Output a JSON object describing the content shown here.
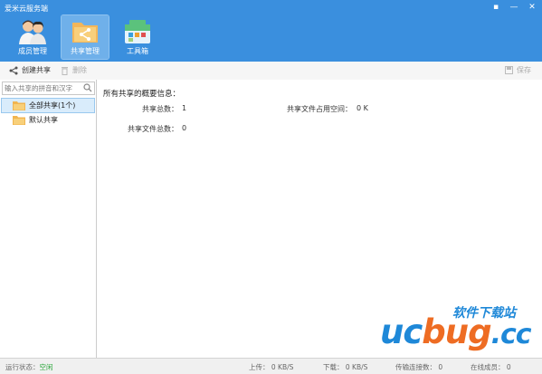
{
  "window": {
    "title": "爱米云服务端",
    "controls": [
      "▪",
      "—",
      "✕"
    ]
  },
  "nav": [
    {
      "label": "成员管理",
      "icon": "members-icon"
    },
    {
      "label": "共享管理",
      "icon": "share-icon",
      "active": true
    },
    {
      "label": "工具箱",
      "icon": "toolbox-icon"
    }
  ],
  "toolbar": {
    "create_label": "创建共享",
    "delete_label": "删除",
    "save_label": "保存"
  },
  "sidebar": {
    "search_placeholder": "输入共享的拼音和汉字",
    "items": [
      {
        "label": "全部共享(1个)",
        "selected": true
      },
      {
        "label": "默认共享",
        "selected": false
      }
    ]
  },
  "main": {
    "title": "所有共享的概要信息：",
    "share_count_label": "共享总数：",
    "share_count_value": "1",
    "space_label": "共享文件占用空间：",
    "space_value": "0 K",
    "file_count_label": "共享文件总数：",
    "file_count_value": "0"
  },
  "watermark": {
    "top": "软件下载站",
    "uc": "uc",
    "bug": "bug",
    "cc": ".cc"
  },
  "statusbar": {
    "run_state_label": "运行状态：",
    "run_state_value": "空闲",
    "upload": "上传：  0 KB/S",
    "download": "下载：  0 KB/S",
    "transfers": "传输连接数：  0",
    "online": "在线成员：  0"
  },
  "colors": {
    "titlebar": "#3a8fde",
    "accent_orange": "#ee6c23",
    "status_green": "#2aa63a"
  }
}
